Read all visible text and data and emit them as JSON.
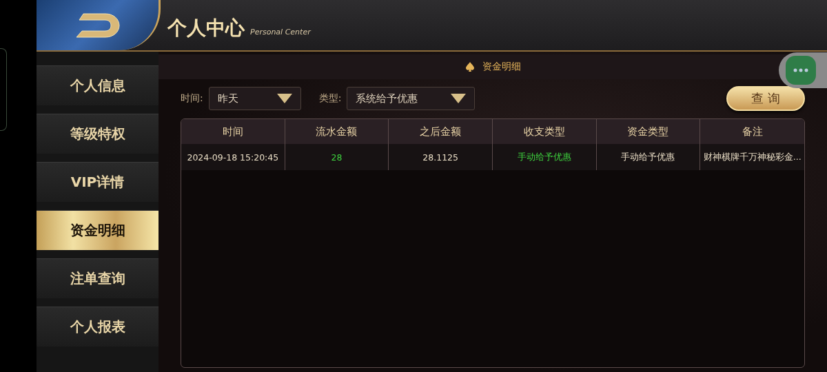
{
  "header": {
    "title": "个人中心",
    "subtitle": "Personal Center"
  },
  "sidebar": {
    "items": [
      {
        "label": "个人信息",
        "selected": false
      },
      {
        "label": "等级特权",
        "selected": false
      },
      {
        "label": "VIP详情",
        "selected": false
      },
      {
        "label": "资金明细",
        "selected": true
      },
      {
        "label": "注单查询",
        "selected": false
      },
      {
        "label": "个人报表",
        "selected": false
      }
    ]
  },
  "section_title": "资金明细",
  "filters": [
    {
      "label": "时间:",
      "value": "昨天"
    },
    {
      "label": "类型:",
      "value": "系统给予优惠"
    }
  ],
  "query_button": "查 询",
  "table": {
    "columns": [
      "时间",
      "流水金额",
      "之后金额",
      "收支类型",
      "资金类型",
      "备注"
    ],
    "rows": [
      [
        {
          "text": "2024-09-18 15:20:45",
          "color": "#e8dcc4"
        },
        {
          "text": "28",
          "color": "#3ed13e"
        },
        {
          "text": "28.1125",
          "color": "#e8dcc4"
        },
        {
          "text": "手动给予优惠",
          "color": "#3ed13e"
        },
        {
          "text": "手动给予优惠",
          "color": "#e8dcc4"
        },
        {
          "text": "财神棋牌千万神秘彩金...",
          "color": "#e8dcc4"
        }
      ]
    ]
  }
}
